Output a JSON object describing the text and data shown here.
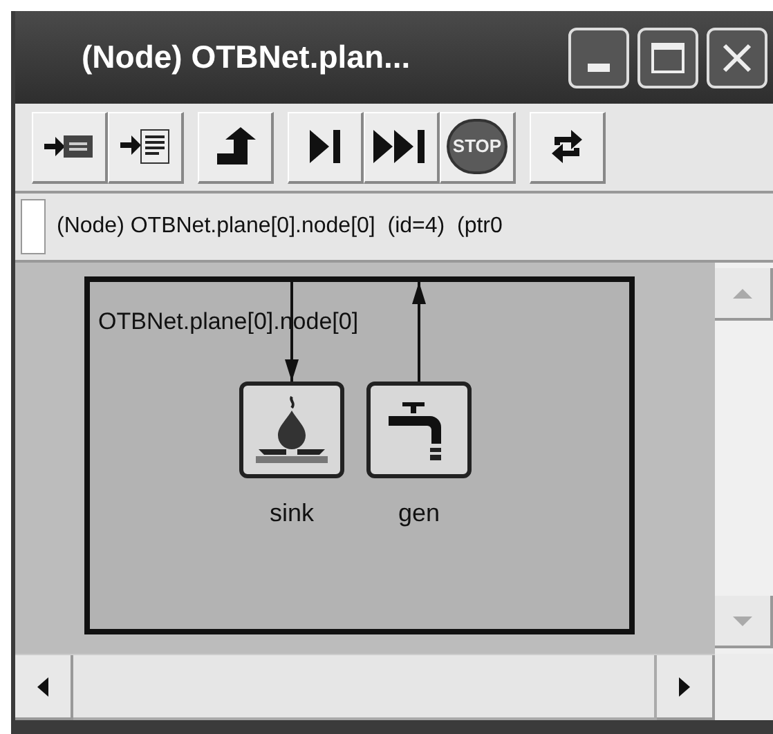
{
  "window": {
    "title": "(Node) OTBNet.plan..."
  },
  "toolbar": [
    {
      "buttons": [
        {
          "kind": "insert-line"
        },
        {
          "kind": "insert-list"
        }
      ]
    },
    {
      "buttons": [
        {
          "kind": "up"
        }
      ]
    },
    {
      "buttons": [
        {
          "kind": "step"
        },
        {
          "kind": "run"
        },
        {
          "kind": "stop",
          "label": "STOP"
        }
      ]
    },
    {
      "buttons": [
        {
          "kind": "refresh"
        }
      ]
    }
  ],
  "info_bar": {
    "text": "(Node) OTBNet.plane[0].node[0]  (id=4)  (ptr0"
  },
  "canvas": {
    "frame_label": "OTBNet.plane[0].node[0]",
    "nodes": [
      {
        "label": "sink",
        "kind": "sink",
        "arrow_into_node": true
      },
      {
        "label": "gen",
        "kind": "gen",
        "arrow_into_node": false
      }
    ]
  }
}
